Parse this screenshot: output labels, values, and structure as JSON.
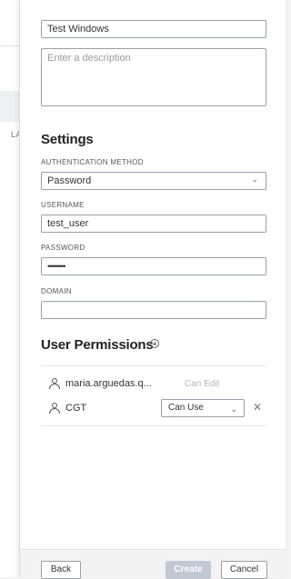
{
  "form": {
    "name_value": "Test Windows",
    "description_placeholder": "Enter a description"
  },
  "settings": {
    "title": "Settings",
    "auth_method_label": "AUTHENTICATION METHOD",
    "auth_method_value": "Password",
    "username_label": "USERNAME",
    "username_value": "test_user",
    "password_label": "PASSWORD",
    "password_masked": "•••••••••",
    "domain_label": "DOMAIN",
    "domain_value": ""
  },
  "permissions": {
    "title": "User Permissions",
    "entries": [
      {
        "name": "maria.arguedas.q...",
        "permission": "Can Edit"
      },
      {
        "name": "CGT",
        "permission": "Can Use"
      }
    ]
  },
  "background": {
    "column_label": "LA"
  },
  "footer": {
    "back_label": "Back",
    "create_label": "Create",
    "cancel_label": "Cancel"
  },
  "colors": {
    "disabled_button": "#c3c9d2",
    "border": "#9aa0a6"
  }
}
